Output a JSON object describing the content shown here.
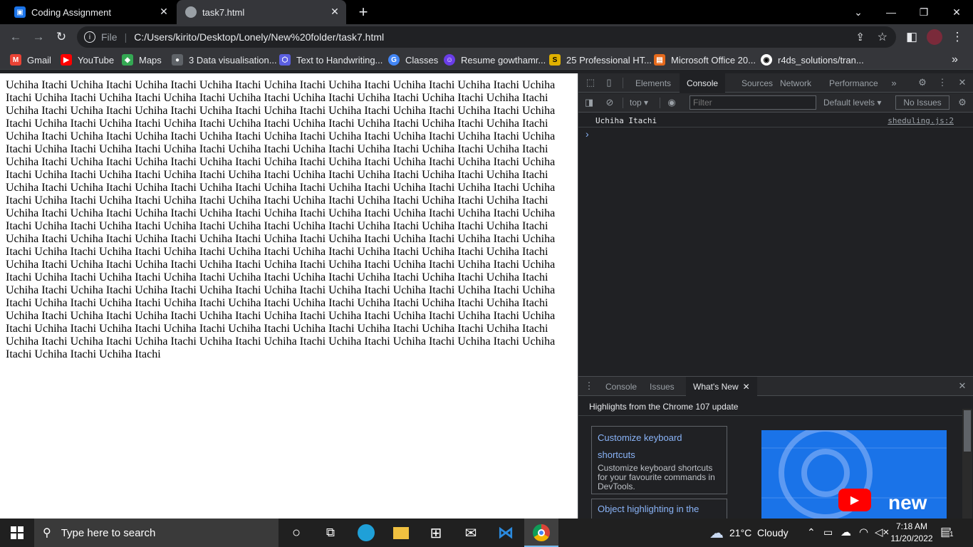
{
  "tabs": [
    {
      "title": "Coding Assignment",
      "close": "✕"
    },
    {
      "title": "task7.html",
      "close": "✕"
    }
  ],
  "new_tab": "+",
  "window_controls": {
    "tab_search": "⌄",
    "minimize": "—",
    "restore": "❐",
    "close": "✕"
  },
  "address_bar": {
    "scheme_label": "File",
    "url": "C:/Users/kirito/Desktop/Lonely/New%20folder/task7.html"
  },
  "bookmarks": [
    {
      "label": "Gmail",
      "icon": "gmail-icon",
      "color": "#ea4335",
      "glyph": "M"
    },
    {
      "label": "YouTube",
      "icon": "youtube-icon",
      "color": "#ff0000",
      "glyph": "▶"
    },
    {
      "label": "Maps",
      "icon": "maps-icon",
      "color": "#34a853",
      "glyph": "◆"
    },
    {
      "label": "3 Data visualisation...",
      "icon": "web-icon",
      "color": "#5f6368",
      "glyph": "●"
    },
    {
      "label": "Text to Handwriting...",
      "icon": "handwriting-icon",
      "color": "#5b5fe0",
      "glyph": "⬡"
    },
    {
      "label": "Classes",
      "icon": "google-icon",
      "color": "#4285f4",
      "glyph": "G"
    },
    {
      "label": "Resume gowthamr...",
      "icon": "resume-icon",
      "color": "#6a3de8",
      "glyph": "☺"
    },
    {
      "label": "25 Professional HT...",
      "icon": "sdr-icon",
      "color": "#e0b100",
      "glyph": "S"
    },
    {
      "label": "Microsoft Office 20...",
      "icon": "office-icon",
      "color": "#e66a1c",
      "glyph": "▤"
    },
    {
      "label": "r4ds_solutions/tran...",
      "icon": "github-icon",
      "color": "#24292e",
      "glyph": "◉"
    }
  ],
  "bookmarks_overflow": "»",
  "page": {
    "text": "Uchiha Itachi Uchiha Itachi Uchiha Itachi Uchiha Itachi Uchiha Itachi Uchiha Itachi Uchiha Itachi Uchiha Itachi Uchiha Itachi Uchiha Itachi Uchiha Itachi Uchiha Itachi Uchiha Itachi Uchiha Itachi Uchiha Itachi Uchiha Itachi Uchiha Itachi Uchiha Itachi Uchiha Itachi Uchiha Itachi Uchiha Itachi Uchiha Itachi Uchiha Itachi Uchiha Itachi Uchiha Itachi Uchiha Itachi Uchiha Itachi Uchiha Itachi Uchiha Itachi Uchiha Itachi Uchiha Itachi Uchiha Itachi Uchiha Itachi Uchiha Itachi Uchiha Itachi Uchiha Itachi Uchiha Itachi Uchiha Itachi Uchiha Itachi Uchiha Itachi Uchiha Itachi Uchiha Itachi Uchiha Itachi Uchiha Itachi Uchiha Itachi Uchiha Itachi Uchiha Itachi Uchiha Itachi Uchiha Itachi Uchiha Itachi Uchiha Itachi Uchiha Itachi Uchiha Itachi Uchiha Itachi Uchiha Itachi Uchiha Itachi Uchiha Itachi Uchiha Itachi Uchiha Itachi Uchiha Itachi Uchiha Itachi Uchiha Itachi Uchiha Itachi Uchiha Itachi Uchiha Itachi Uchiha Itachi Uchiha Itachi Uchiha Itachi Uchiha Itachi Uchiha Itachi Uchiha Itachi Uchiha Itachi Uchiha Itachi Uchiha Itachi Uchiha Itachi Uchiha Itachi Uchiha Itachi Uchiha Itachi Uchiha Itachi Uchiha Itachi Uchiha Itachi Uchiha Itachi Uchiha Itachi Uchiha Itachi Uchiha Itachi Uchiha Itachi Uchiha Itachi Uchiha Itachi Uchiha Itachi Uchiha Itachi Uchiha Itachi Uchiha Itachi Uchiha Itachi Uchiha Itachi Uchiha Itachi Uchiha Itachi Uchiha Itachi Uchiha Itachi Uchiha Itachi Uchiha Itachi Uchiha Itachi Uchiha Itachi Uchiha Itachi Uchiha Itachi Uchiha Itachi Uchiha Itachi Uchiha Itachi Uchiha Itachi Uchiha Itachi Uchiha Itachi Uchiha Itachi Uchiha Itachi Uchiha Itachi Uchiha Itachi Uchiha Itachi Uchiha Itachi Uchiha Itachi Uchiha Itachi Uchiha Itachi Uchiha Itachi Uchiha Itachi Uchiha Itachi Uchiha Itachi Uchiha Itachi Uchiha Itachi Uchiha Itachi Uchiha Itachi Uchiha Itachi Uchiha Itachi Uchiha Itachi Uchiha Itachi Uchiha Itachi Uchiha Itachi Uchiha Itachi Uchiha Itachi Uchiha Itachi Uchiha Itachi Uchiha Itachi Uchiha Itachi Uchiha Itachi Uchiha Itachi Uchiha Itachi Uchiha Itachi Uchiha Itachi Uchiha Itachi Uchiha Itachi Uchiha Itachi Uchiha Itachi Uchiha Itachi Uchiha Itachi Uchiha Itachi Uchiha Itachi Uchiha Itachi Uchiha Itachi Uchiha Itachi Uchiha Itachi Uchiha Itachi Uchiha Itachi Uchiha Itachi Uchiha Itachi Uchiha Itachi Uchiha Itachi Uchiha Itachi Uchiha Itachi Uchiha Itachi Uchiha Itachi Uchiha Itachi Uchiha Itachi Uchiha Itachi Uchiha Itachi Uchiha Itachi Uchiha Itachi Uchiha Itachi Uchiha Itachi Uchiha Itachi Uchiha Itachi Uchiha Itachi Uchiha Itachi Uchiha Itachi Uchiha Itachi Uchiha Itachi"
  },
  "devtools": {
    "tabs": [
      "Elements",
      "Console",
      "Sources",
      "Network",
      "Performance"
    ],
    "active_tab": "Console",
    "more_tabs": "»",
    "context": "top",
    "filter_placeholder": "Filter",
    "levels": "Default levels",
    "issues": "No Issues",
    "console_message": "Uchiha Itachi",
    "console_source": "sheduling.js:2",
    "prompt": "›",
    "drawer": {
      "tabs": [
        "Console",
        "Issues",
        "What's New"
      ],
      "active_tab": "What's New",
      "close": "✕",
      "headline": "Highlights from the Chrome 107 update",
      "cards": [
        {
          "title": "Customize keyboard shortcuts",
          "body": "Customize keyboard shortcuts for your favourite commands in DevTools."
        },
        {
          "title": "Object highlighting in the",
          "body": ""
        }
      ],
      "video_label": "new"
    }
  },
  "taskbar": {
    "search_placeholder": "Type here to search",
    "weather": "21°C  Cloudy",
    "time": "7:18 AM",
    "date": "11/20/2022",
    "notification_count": "1"
  },
  "colors": {
    "accent": "#8ab4f8",
    "link": "#8ab4f8"
  }
}
